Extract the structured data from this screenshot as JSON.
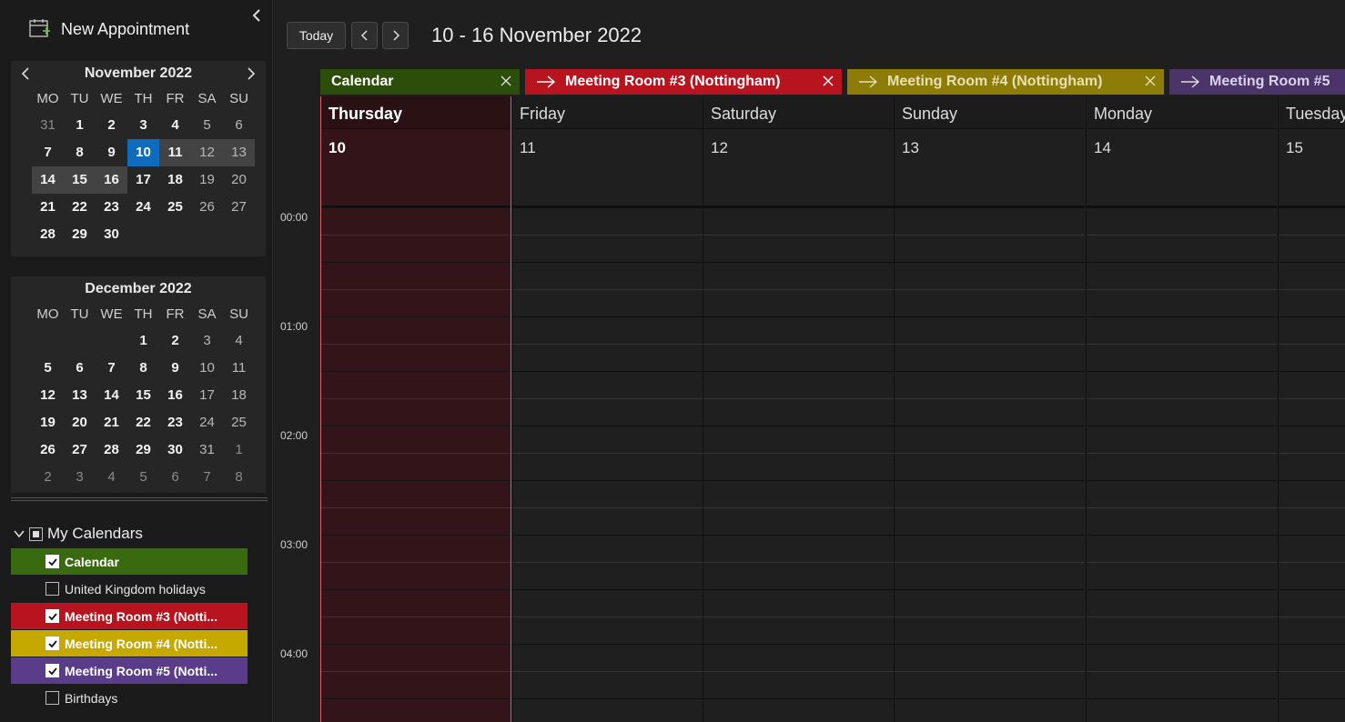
{
  "sidebar": {
    "new_appointment_label": "New Appointment",
    "mini_cal_1": {
      "title": "November 2022",
      "weekdays": [
        "MO",
        "TU",
        "WE",
        "TH",
        "FR",
        "SA",
        "SU"
      ],
      "weeks": [
        [
          "31",
          "1",
          "2",
          "3",
          "4",
          "5",
          "6"
        ],
        [
          "7",
          "8",
          "9",
          "10",
          "11",
          "12",
          "13"
        ],
        [
          "14",
          "15",
          "16",
          "17",
          "18",
          "19",
          "20"
        ],
        [
          "21",
          "22",
          "23",
          "24",
          "25",
          "26",
          "27"
        ],
        [
          "28",
          "29",
          "30",
          "",
          "",
          "",
          ""
        ]
      ]
    },
    "mini_cal_2": {
      "title": "December 2022",
      "weekdays": [
        "MO",
        "TU",
        "WE",
        "TH",
        "FR",
        "SA",
        "SU"
      ],
      "weeks": [
        [
          "",
          "",
          "",
          "1",
          "2",
          "3",
          "4"
        ],
        [
          "5",
          "6",
          "7",
          "8",
          "9",
          "10",
          "11"
        ],
        [
          "12",
          "13",
          "14",
          "15",
          "16",
          "17",
          "18"
        ],
        [
          "19",
          "20",
          "21",
          "22",
          "23",
          "24",
          "25"
        ],
        [
          "26",
          "27",
          "28",
          "29",
          "30",
          "31",
          "1"
        ],
        [
          "2",
          "3",
          "4",
          "5",
          "6",
          "7",
          "8"
        ]
      ]
    },
    "my_calendars_label": "My Calendars",
    "calendars": [
      {
        "label": "Calendar",
        "checked": true,
        "color": "#3a6a0f"
      },
      {
        "label": "United Kingdom holidays",
        "checked": false,
        "color": ""
      },
      {
        "label": "Meeting Room #3 (Notti...",
        "checked": true,
        "color": "#b8141f"
      },
      {
        "label": "Meeting Room #4 (Notti...",
        "checked": true,
        "color": "#c5a800"
      },
      {
        "label": "Meeting Room #5 (Notti...",
        "checked": true,
        "color": "#5a3c8a"
      },
      {
        "label": "Birthdays",
        "checked": false,
        "color": ""
      }
    ]
  },
  "toolbar": {
    "today_label": "Today",
    "range_title": "10 - 16 November 2022"
  },
  "tabs": [
    {
      "label": "Calendar",
      "color": "#2d4d0b"
    },
    {
      "label": "Meeting Room #3 (Nottingham)",
      "color": "#b8141f"
    },
    {
      "label": "Meeting Room #4 (Nottingham)",
      "color": "#8e7c08"
    },
    {
      "label": "Meeting Room #5",
      "color": "#4a3468"
    }
  ],
  "days": [
    {
      "name": "Thursday",
      "num": "10"
    },
    {
      "name": "Friday",
      "num": "11"
    },
    {
      "name": "Saturday",
      "num": "12"
    },
    {
      "name": "Sunday",
      "num": "13"
    },
    {
      "name": "Monday",
      "num": "14"
    },
    {
      "name": "Tuesday",
      "num": "15"
    }
  ],
  "times": [
    "00:00",
    "01:00",
    "02:00",
    "03:00",
    "04:00"
  ],
  "colors": {
    "today_accent": "#0f6cbd",
    "today_column_bg": "#331519",
    "today_column_border": "#e0606a"
  }
}
